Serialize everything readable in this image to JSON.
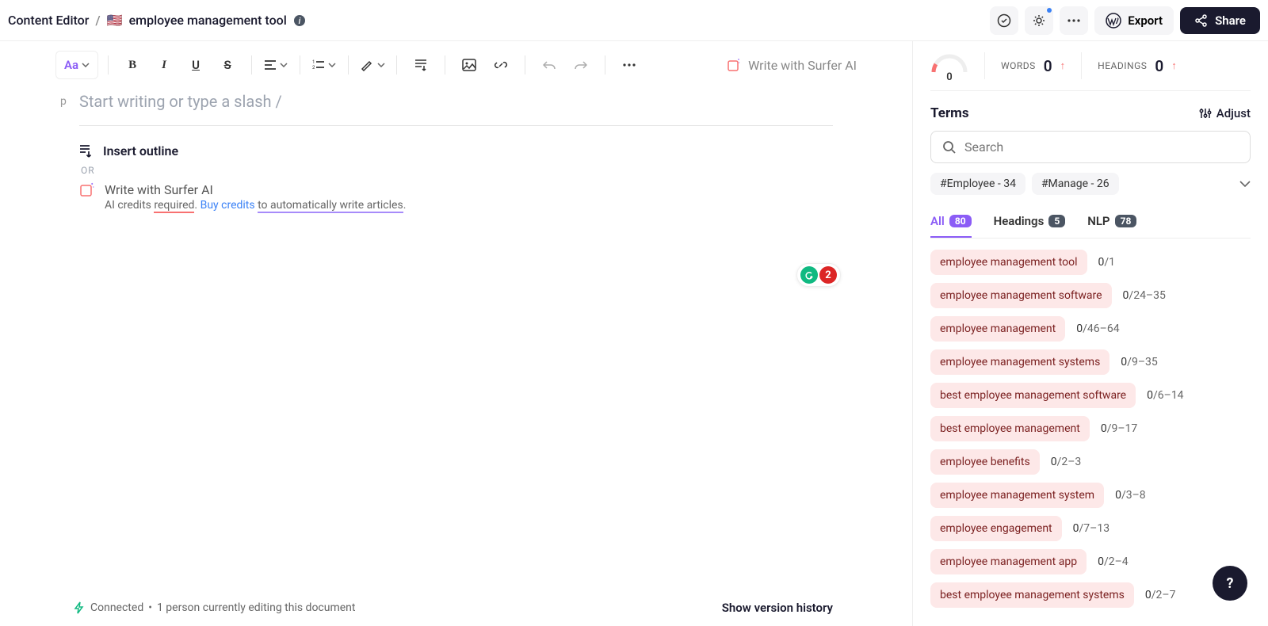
{
  "header": {
    "breadcrumb_root": "Content Editor",
    "flag": "🇺🇸",
    "title": "employee management tool",
    "export_label": "Export",
    "share_label": "Share"
  },
  "toolbar": {
    "text_style": "Aa",
    "write_ai": "Write with Surfer AI"
  },
  "editor": {
    "p_marker": "p",
    "placeholder": "Start writing or type a slash /",
    "insert_outline": "Insert outline",
    "or": "OR",
    "write_ai_title": "Write with Surfer AI",
    "write_ai_sub_1": "AI credits ",
    "write_ai_sub_2": "required",
    "write_ai_sub_3": ". ",
    "write_ai_sub_4": "Buy credits",
    "write_ai_sub_5": " ",
    "write_ai_sub_6": "to automatically write articles",
    "write_ai_sub_7": ".",
    "badge_count": "2"
  },
  "footer": {
    "status": "Connected",
    "editing": "1 person currently editing this document",
    "version": "Show version history"
  },
  "stats": {
    "gauge": "0",
    "words_label": "WORDS",
    "words_val": "0",
    "headings_label": "HEADINGS",
    "headings_val": "0"
  },
  "terms": {
    "title": "Terms",
    "adjust": "Adjust",
    "search_placeholder": "Search",
    "chips": [
      "#Employee - 34",
      "#Manage - 26"
    ],
    "tabs": [
      {
        "label": "All",
        "count": "80"
      },
      {
        "label": "Headings",
        "count": "5"
      },
      {
        "label": "NLP",
        "count": "78"
      }
    ],
    "items": [
      {
        "text": "employee management tool",
        "current": "0",
        "range": "/1"
      },
      {
        "text": "employee management software",
        "current": "0",
        "range": "/24–35"
      },
      {
        "text": "employee management",
        "current": "0",
        "range": "/46–64"
      },
      {
        "text": "employee management systems",
        "current": "0",
        "range": "/9–35"
      },
      {
        "text": "best employee management software",
        "current": "0",
        "range": "/6–14"
      },
      {
        "text": "best employee management",
        "current": "0",
        "range": "/9–17"
      },
      {
        "text": "employee benefits",
        "current": "0",
        "range": "/2–3"
      },
      {
        "text": "employee management system",
        "current": "0",
        "range": "/3–8"
      },
      {
        "text": "employee engagement",
        "current": "0",
        "range": "/7–13"
      },
      {
        "text": "employee management app",
        "current": "0",
        "range": "/2–4"
      },
      {
        "text": "best employee management systems",
        "current": "0",
        "range": "/2–7"
      }
    ]
  }
}
